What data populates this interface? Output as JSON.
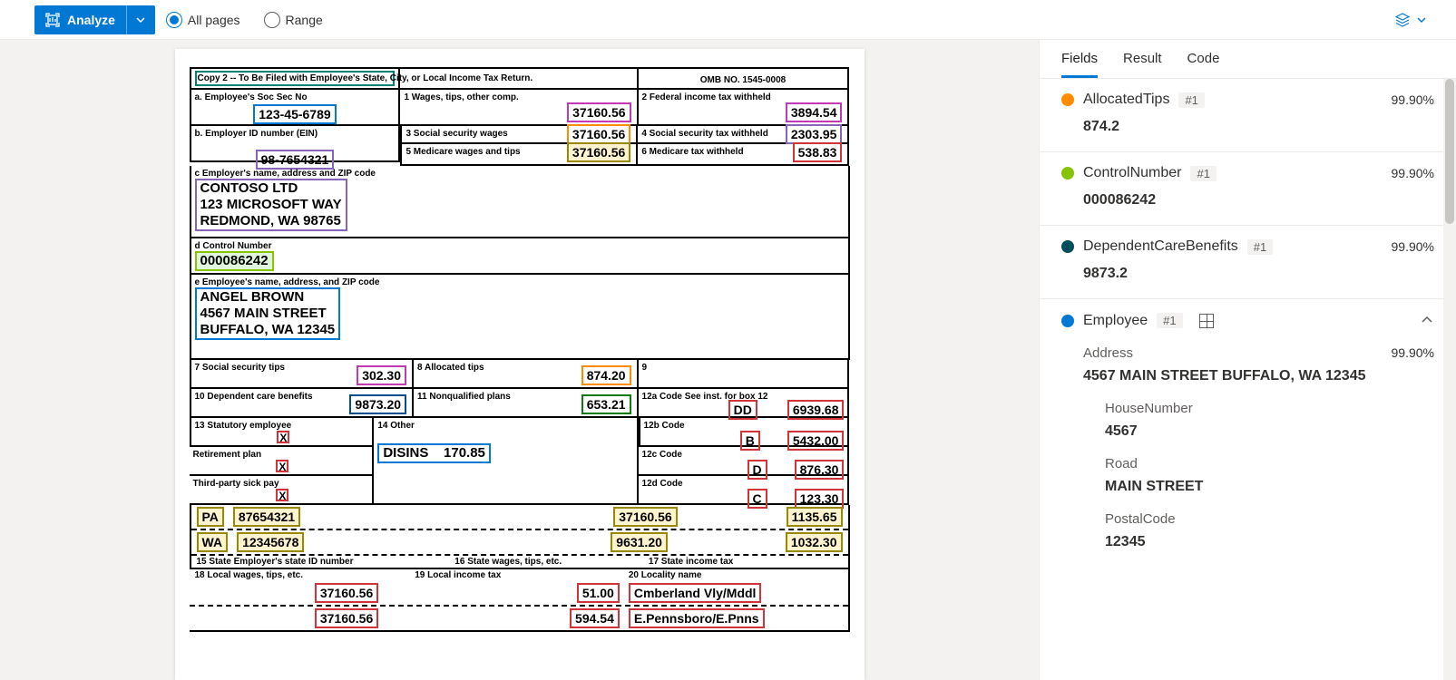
{
  "toolbar": {
    "analyze_label": "Analyze",
    "all_pages_label": "All pages",
    "range_label": "Range"
  },
  "tabs": {
    "fields": "Fields",
    "result": "Result",
    "code": "Code"
  },
  "fields": [
    {
      "name": "AllocatedTips",
      "badge": "#1",
      "conf": "99.90%",
      "value": "874.2",
      "dot": "dot-orange"
    },
    {
      "name": "ControlNumber",
      "badge": "#1",
      "conf": "99.90%",
      "value": "000086242",
      "dot": "dot-lime"
    },
    {
      "name": "DependentCareBenefits",
      "badge": "#1",
      "conf": "99.90%",
      "value": "9873.2",
      "dot": "dot-teal"
    }
  ],
  "employee": {
    "name": "Employee",
    "badge": "#1",
    "address_label": "Address",
    "address_conf": "99.90%",
    "address_value": "4567 MAIN STREET BUFFALO, WA 12345",
    "house_label": "HouseNumber",
    "house_value": "4567",
    "road_label": "Road",
    "road_value": "MAIN STREET",
    "postal_label": "PostalCode",
    "postal_value": "12345"
  },
  "form": {
    "copy2": "Copy 2 -- To Be Filed with Employee's State, City, or Local Income Tax Return.",
    "omb": "OMB NO. 1545-0008",
    "a_lbl": "a. Employee's Soc Sec No",
    "a_val": "123-45-6789",
    "b_lbl": "b. Employer ID number (EIN)",
    "b_val": "98-7654321",
    "c_lbl": "c Employer's name, address and ZIP code",
    "c_line1": "CONTOSO LTD",
    "c_line2": "123 MICROSOFT WAY",
    "c_line3": "REDMOND, WA 98765",
    "d_lbl": "d Control Number",
    "d_val": "000086242",
    "e_lbl": "e Employee's name, address, and ZIP code",
    "e_line1": "ANGEL BROWN",
    "e_line2": "4567 MAIN STREET",
    "e_line3": "BUFFALO, WA 12345",
    "box1_lbl": "1 Wages, tips, other comp.",
    "box1_val": "37160.56",
    "box2_lbl": "2 Federal income tax withheld",
    "box2_val": "3894.54",
    "box3_lbl": "3 Social security wages",
    "box3_val": "37160.56",
    "box4_lbl": "4 Social security tax withheld",
    "box4_val": "2303.95",
    "box5_lbl": "5 Medicare wages and tips",
    "box5_val": "37160.56",
    "box6_lbl": "6 Medicare tax withheld",
    "box6_val": "538.83",
    "box7_lbl": "7 Social security tips",
    "box7_val": "302.30",
    "box8_lbl": "8 Allocated tips",
    "box8_val": "874.20",
    "box9_lbl": "9",
    "box10_lbl": "10 Dependent care benefits",
    "box10_val": "9873.20",
    "box11_lbl": "11 Nonqualified plans",
    "box11_val": "653.21",
    "box12a_lbl": "12a Code See inst. for box 12",
    "box12a_code": "DD",
    "box12a_val": "6939.68",
    "box12b_lbl": "12b Code",
    "box12b_code": "B",
    "box12b_val": "5432.00",
    "box12c_lbl": "12c Code",
    "box12c_code": "D",
    "box12c_val": "876.30",
    "box12d_lbl": "12d Code",
    "box12d_code": "C",
    "box12d_val": "123.30",
    "box13_lbl": "13 Statutory employee",
    "box13_ret": "Retirement plan",
    "box13_sick": "Third-party sick pay",
    "box14_lbl": "14 Other",
    "box14_val": "DISINS    170.85",
    "state1_abbr": "PA",
    "state1_id": "87654321",
    "state1_wages": "37160.56",
    "state1_tax": "1135.65",
    "state2_abbr": "WA",
    "state2_id": "12345678",
    "state2_wages": "9631.20",
    "state2_tax": "1032.30",
    "box15_lbl": "15 State Employer's state ID number",
    "box16_lbl": "16 State wages, tips, etc.",
    "box17_lbl": "17 State income tax",
    "box18_lbl": "18 Local wages, tips, etc.",
    "box19_lbl": "19 Local income tax",
    "box20_lbl": "20 Locality name",
    "local1_wages": "37160.56",
    "local1_tax": "51.00",
    "local1_name": "Cmberland Vly/Mddl",
    "local2_wages": "37160.56",
    "local2_tax": "594.54",
    "local2_name": "E.Pennsboro/E.Pnns",
    "x": "X"
  }
}
